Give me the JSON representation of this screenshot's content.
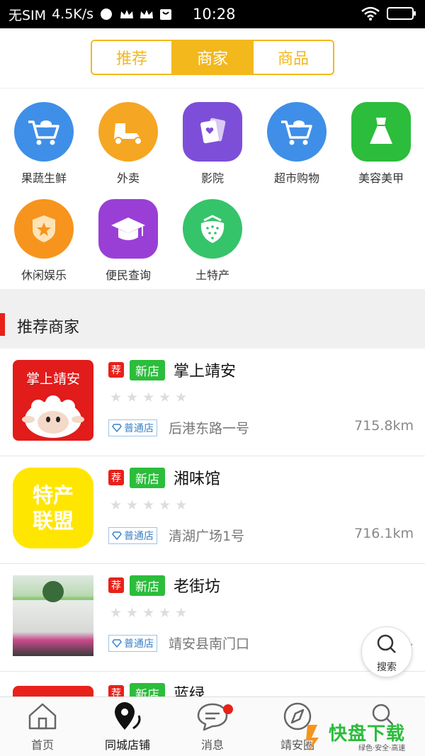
{
  "status_bar": {
    "carrier": "无SIM",
    "speed": "4.5K/s",
    "time": "10:28"
  },
  "tabs": [
    {
      "label": "推荐"
    },
    {
      "label": "商家"
    },
    {
      "label": "商品"
    }
  ],
  "categories": [
    {
      "label": "果蔬生鲜",
      "icon": "cart-icon",
      "color": "#3f8fe8"
    },
    {
      "label": "外卖",
      "icon": "scooter-icon",
      "color": "#f5a623"
    },
    {
      "label": "影院",
      "icon": "cards-icon",
      "color": "#7d4fd8"
    },
    {
      "label": "超市购物",
      "icon": "cart-icon",
      "color": "#3f8fe8"
    },
    {
      "label": "美容美甲",
      "icon": "dress-icon",
      "color": "#2bbd3b"
    },
    {
      "label": "休闲娱乐",
      "icon": "shield-star-icon",
      "color": "#f7941d"
    },
    {
      "label": "便民查询",
      "icon": "grad-cap-icon",
      "color": "#9a3fd6"
    },
    {
      "label": "土特产",
      "icon": "strawberry-icon",
      "color": "#35c46a"
    }
  ],
  "section": {
    "title": "推荐商家"
  },
  "merchants": [
    {
      "rec": "荐",
      "new": "新店",
      "name": "掌上靖安",
      "level": "普通店",
      "address": "后港东路一号",
      "distance": "715.8km",
      "thumb_text": "掌上靖安",
      "rating": 0
    },
    {
      "rec": "荐",
      "new": "新店",
      "name": "湘味馆",
      "level": "普通店",
      "address": "清湖广场1号",
      "distance": "716.1km",
      "thumb_text": "特产联盟",
      "rating": 0
    },
    {
      "rec": "荐",
      "new": "新店",
      "name": "老街坊",
      "level": "普通店",
      "address": "靖安县南门口",
      "distance": "71…",
      "rating": 0
    },
    {
      "rec": "荐",
      "new": "新店",
      "name": "蓝绿"
    }
  ],
  "float_search": {
    "label": "搜索"
  },
  "bottom_nav": [
    {
      "label": "首页",
      "icon": "home-icon"
    },
    {
      "label": "同城店铺",
      "icon": "location-icon"
    },
    {
      "label": "消息",
      "icon": "message-icon"
    },
    {
      "label": "靖安圈",
      "icon": "compass-icon"
    },
    {
      "label": "",
      "icon": "search-icon"
    }
  ],
  "watermark": {
    "text": "快盘下载",
    "sub": "绿色·安全·高速"
  },
  "colors": {
    "accent": "#f2b81c",
    "red": "#e8211a",
    "green": "#2bbd3b"
  }
}
